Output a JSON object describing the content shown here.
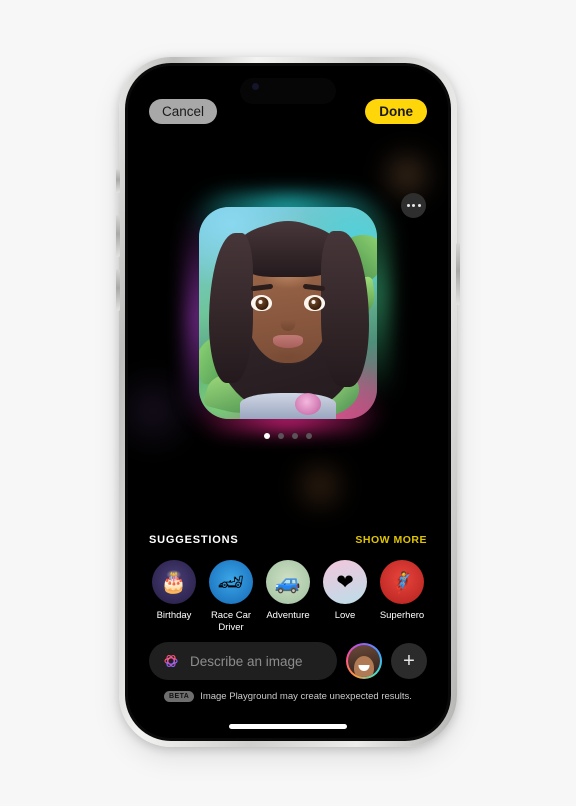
{
  "app": {
    "name": "Image Playground"
  },
  "top_bar": {
    "cancel_label": "Cancel",
    "done_label": "Done",
    "cancel_bg": "#a8a8a8",
    "done_bg": "#ffd60a"
  },
  "canvas": {
    "more_options_icon": "ellipsis-icon",
    "page_dots": {
      "total": 4,
      "active_index": 0
    },
    "generated_image": {
      "subject": "stylized portrait of a smiling girl with long curly hair among green leaves",
      "glow_colors": [
        "#28e6e6",
        "#46dc96",
        "#ff2896",
        "#be46e6"
      ]
    }
  },
  "suggestions": {
    "title": "SUGGESTIONS",
    "show_more_label": "SHOW MORE",
    "show_more_color": "#e0c400",
    "items": [
      {
        "label": "Birthday",
        "icon": "birthday-cake-icon",
        "glyph": "🎂",
        "bg": "#241c42"
      },
      {
        "label": "Race Car Driver",
        "icon": "racing-helmet-icon",
        "glyph": "🏎",
        "bg": "#1567b5"
      },
      {
        "label": "Adventure",
        "icon": "offroad-truck-icon",
        "glyph": "🚙",
        "bg": "#9fc0a0"
      },
      {
        "label": "Love",
        "icon": "heart-icon",
        "glyph": "❤",
        "bg": "#f3c6dc"
      },
      {
        "label": "Superhero",
        "icon": "superhero-icon",
        "glyph": "🦸",
        "bg": "#b4201e"
      }
    ]
  },
  "input_bar": {
    "placeholder": "Describe an image",
    "value": "",
    "sparkle_icon": "apple-intelligence-icon",
    "avatar_icon": "person-avatar-icon",
    "add_icon": "plus-icon",
    "add_label": "+"
  },
  "disclaimer": {
    "badge": "BETA",
    "text": "Image Playground may create unexpected results."
  }
}
